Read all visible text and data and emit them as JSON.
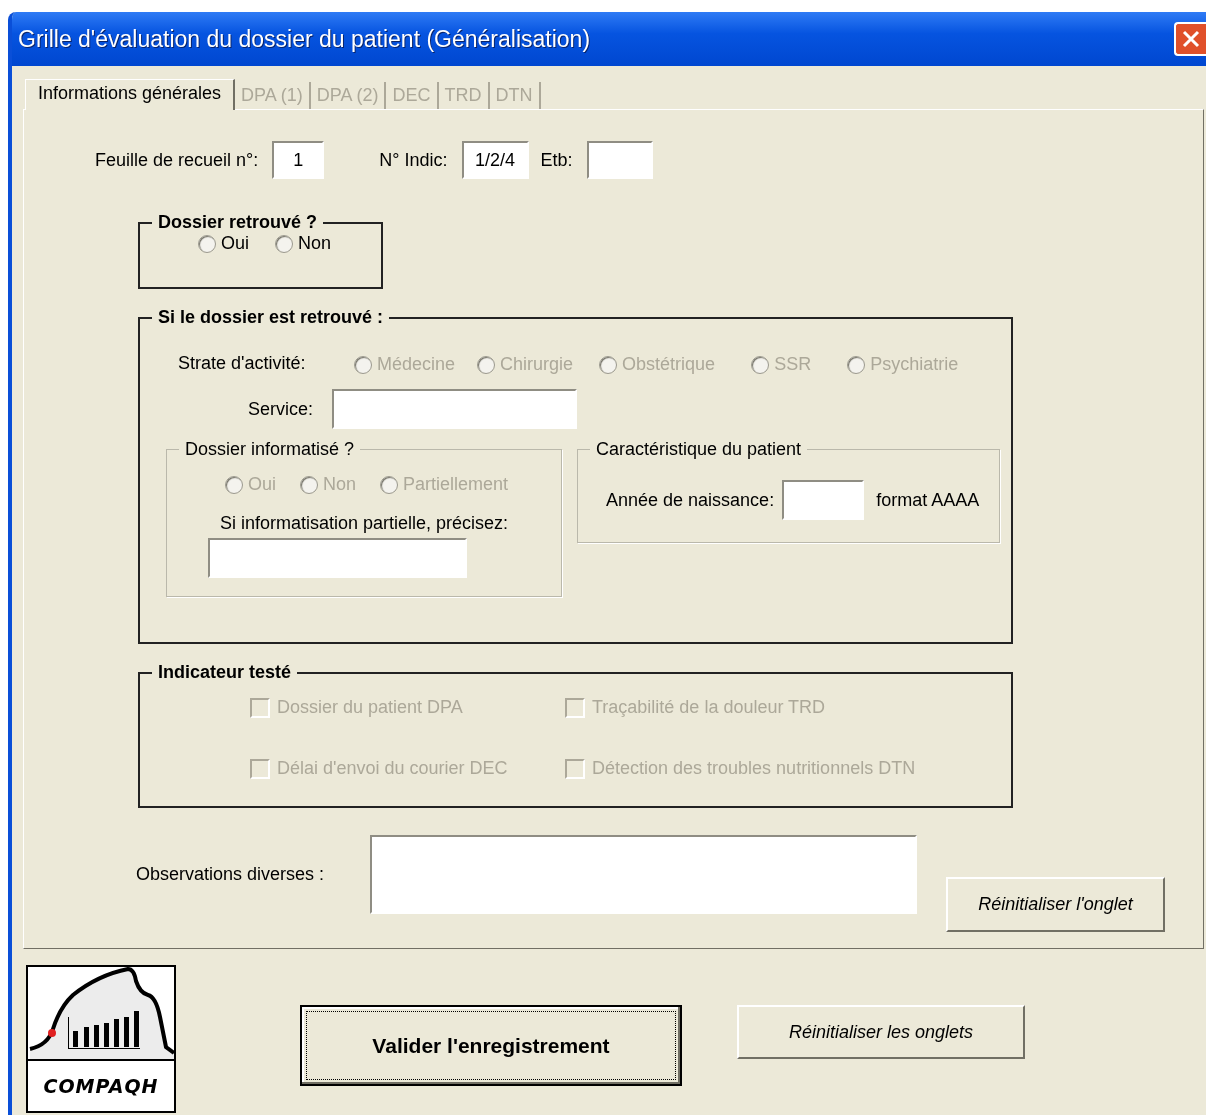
{
  "window": {
    "title": "Grille d'évaluation du dossier du patient (Généralisation)"
  },
  "tabs": [
    {
      "label": "Informations générales",
      "selected": true,
      "disabled": false
    },
    {
      "label": "DPA (1)",
      "selected": false,
      "disabled": true
    },
    {
      "label": "DPA (2)",
      "selected": false,
      "disabled": true
    },
    {
      "label": "DEC",
      "selected": false,
      "disabled": true
    },
    {
      "label": "TRD",
      "selected": false,
      "disabled": true
    },
    {
      "label": "DTN",
      "selected": false,
      "disabled": true
    }
  ],
  "header_fields": [
    {
      "label": "Feuille de recueil n°:",
      "value": "1"
    },
    {
      "label": "N° Indic:",
      "value": "1/2/4"
    },
    {
      "label": "Etb:"
    }
  ],
  "dossier_retrouve": {
    "title": "Dossier retrouvé ?",
    "options": [
      {
        "label": "Oui",
        "selected": false,
        "disabled": false
      },
      {
        "label": "Non",
        "selected": false,
        "disabled": false
      }
    ]
  },
  "si_retrouve": {
    "title": "Si le dossier est retrouvé :",
    "strate": {
      "label": "Strate d'activité:",
      "options": [
        {
          "label": "Médecine",
          "selected": false,
          "disabled": true
        },
        {
          "label": "Chirurgie",
          "selected": false,
          "disabled": true
        },
        {
          "label": "Obstétrique",
          "selected": false,
          "disabled": true
        },
        {
          "label": "SSR",
          "selected": false,
          "disabled": true
        },
        {
          "label": "Psychiatrie",
          "selected": false,
          "disabled": true
        }
      ]
    },
    "service": {
      "label": "Service:"
    },
    "informatise": {
      "title": "Dossier informatisé ?",
      "options": [
        {
          "label": "Oui",
          "selected": false,
          "disabled": true
        },
        {
          "label": "Non",
          "selected": false,
          "disabled": true
        },
        {
          "label": "Partiellement",
          "selected": false,
          "disabled": true
        }
      ],
      "detail_label": "Si informatisation partielle, précisez:"
    },
    "caracteristique": {
      "title": "Caractéristique du patient",
      "birth_label": "Année de naissance:",
      "format_hint": "format AAAA"
    }
  },
  "indicateur": {
    "title": "Indicateur testé",
    "items": [
      {
        "label": "Dossier du patient DPA",
        "checked": false,
        "disabled": true
      },
      {
        "label": "Traçabilité de la douleur TRD",
        "checked": false,
        "disabled": true
      },
      {
        "label": "Délai d'envoi du courier DEC",
        "checked": false,
        "disabled": true
      },
      {
        "label": "Détection des troubles nutritionnels DTN",
        "checked": false,
        "disabled": true
      }
    ]
  },
  "observations": {
    "label": "Observations diverses :"
  },
  "reset_tab_button": "Réinitialiser l'onglet",
  "logo": {
    "text": "COMPAQH"
  },
  "validate_button": "Valider l'enregistrement",
  "reset_all_button": "Réinitialiser les onglets"
}
